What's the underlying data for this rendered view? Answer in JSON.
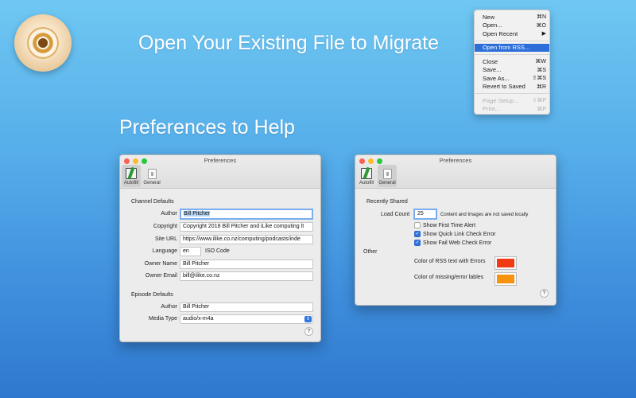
{
  "headlines": {
    "open": "Open Your Existing File to Migrate",
    "prefs": "Preferences to Help"
  },
  "icons": {
    "app": "app-icon-disc"
  },
  "menu": {
    "items": [
      {
        "label": "New",
        "shortcut": "⌘N"
      },
      {
        "label": "Open...",
        "shortcut": "⌘O"
      },
      {
        "label": "Open Recent",
        "shortcut": "▶"
      },
      {
        "label": "Open from RSS...",
        "shortcut": ""
      },
      {
        "label": "Close",
        "shortcut": "⌘W"
      },
      {
        "label": "Save...",
        "shortcut": "⌘S"
      },
      {
        "label": "Save As...",
        "shortcut": "⇧⌘S"
      },
      {
        "label": "Revert to Saved",
        "shortcut": "⌘R"
      },
      {
        "label": "Page Setup...",
        "shortcut": "⇧⌘P"
      },
      {
        "label": "Print...",
        "shortcut": "⌘P"
      }
    ]
  },
  "prefs_left": {
    "title": "Preferences",
    "tabs": [
      "Autofill",
      "General"
    ],
    "channel_defaults": "Channel Defaults",
    "author_label": "Author",
    "author_value": "Bill Pitcher",
    "copyright_label": "Copyright",
    "copyright_value": "Copyright 2018 Bill Pitcher and iLike computing lt",
    "site_url_label": "Site URL",
    "site_url_value": "https://www.ilike.co.nz/computing/podcasts/inde",
    "language_label": "Language",
    "language_value": "en",
    "language_note": "ISO Code",
    "owner_name_label": "Owner Name",
    "owner_name_value": "Bill Pitcher",
    "owner_email_label": "Owner Email",
    "owner_email_value": "bill@ilike.co.nz",
    "episode_defaults": "Episode Defaults",
    "ep_author_label": "Author",
    "ep_author_value": "Bill Pitcher",
    "media_type_label": "Media Type",
    "media_type_value": "audio/x-m4a",
    "help": "?"
  },
  "prefs_right": {
    "title": "Preferences",
    "tabs": [
      "Autofill",
      "General"
    ],
    "recently_shared": "Recently Shared",
    "load_count_label": "Load Count",
    "load_count_value": "25",
    "load_count_note": "Content and Images are not saved locally",
    "checks": [
      {
        "label": "Show First Time Alert",
        "checked": false
      },
      {
        "label": "Show Quick Link Check Error",
        "checked": true
      },
      {
        "label": "Show Fail Web Check Error",
        "checked": true
      }
    ],
    "other": "Other",
    "rss_color_label": "Color of RSS text with Errors",
    "rss_color": "#f23a12",
    "missing_color_label": "Color of missing/error lables",
    "missing_color": "#f7920e",
    "help": "?"
  }
}
